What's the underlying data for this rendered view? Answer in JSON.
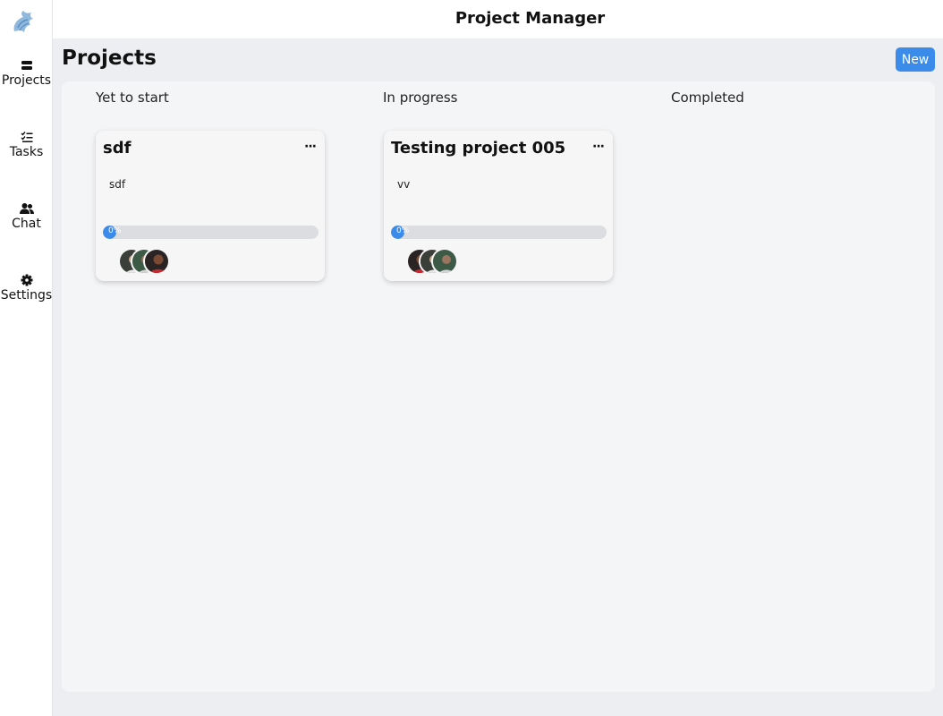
{
  "app": {
    "title": "Project Manager"
  },
  "sidebar": {
    "items": [
      {
        "label": "Projects",
        "icon": "projects-icon"
      },
      {
        "label": "Tasks",
        "icon": "tasks-icon"
      },
      {
        "label": "Chat",
        "icon": "chat-icon"
      },
      {
        "label": "Settings",
        "icon": "gear-icon"
      }
    ]
  },
  "page": {
    "title": "Projects",
    "new_label": "New"
  },
  "columns": [
    {
      "title": "Yet to start"
    },
    {
      "title": "In progress"
    },
    {
      "title": "Completed"
    }
  ],
  "cards": [
    {
      "title": "sdf",
      "description": "sdf",
      "progress": 0,
      "progress_label": "0%",
      "menu": "···",
      "column": "Yet to start"
    },
    {
      "title": "Testing project 005",
      "description": "vv",
      "progress": 0,
      "progress_label": "0%",
      "menu": "···",
      "column": "In progress"
    }
  ],
  "colors": {
    "accent": "#3b8beb",
    "board": "#f4f5f7",
    "page_bg": "#eceef1"
  }
}
